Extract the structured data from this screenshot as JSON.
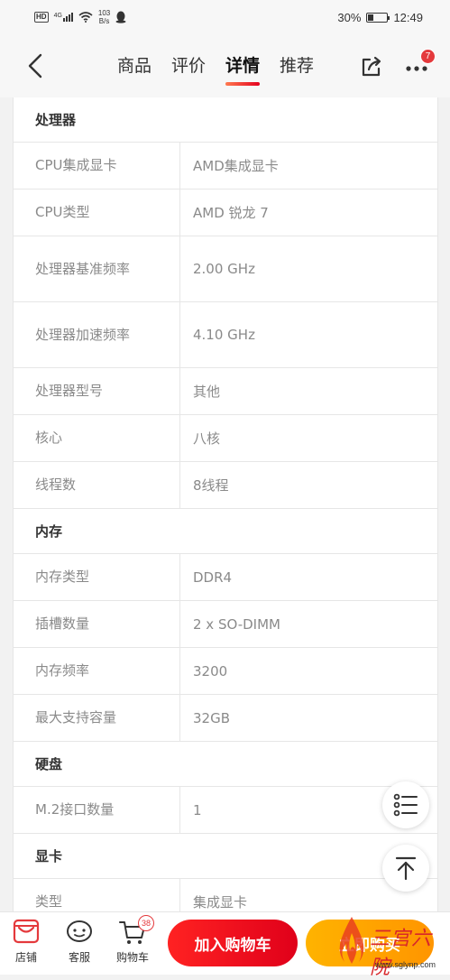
{
  "status_bar": {
    "network_tag": "HD",
    "signal": "4G",
    "speed_value": "103",
    "speed_unit": "B/s",
    "battery_percent": "30%",
    "battery_level": 0.3,
    "time": "12:49"
  },
  "nav": {
    "tabs": [
      {
        "label": "商品",
        "active": false
      },
      {
        "label": "评价",
        "active": false
      },
      {
        "label": "详情",
        "active": true
      },
      {
        "label": "推荐",
        "active": false
      }
    ],
    "more_badge": "7"
  },
  "specs": {
    "processor": {
      "title": "处理器",
      "rows": [
        {
          "label": "CPU集成显卡",
          "value": "AMD集成显卡"
        },
        {
          "label": "CPU类型",
          "value": "AMD 锐龙 7"
        },
        {
          "label": "处理器基准频率",
          "value": "2.00 GHz"
        },
        {
          "label": "处理器加速频率",
          "value": "4.10 GHz"
        },
        {
          "label": "处理器型号",
          "value": "其他"
        },
        {
          "label": "核心",
          "value": "八核"
        },
        {
          "label": "线程数",
          "value": "8线程"
        }
      ]
    },
    "memory": {
      "title": "内存",
      "rows": [
        {
          "label": "内存类型",
          "value": "DDR4"
        },
        {
          "label": "插槽数量",
          "value": "2 x SO-DIMM"
        },
        {
          "label": "内存频率",
          "value": "3200"
        },
        {
          "label": "最大支持容量",
          "value": "32GB"
        }
      ]
    },
    "disk": {
      "title": "硬盘",
      "rows": [
        {
          "label": "M.2接口数量",
          "value": "1"
        }
      ]
    },
    "gpu": {
      "title": "显卡",
      "rows": [
        {
          "label": "类型",
          "value": "集成显卡"
        }
      ]
    }
  },
  "bottom_bar": {
    "shop": "店铺",
    "service": "客服",
    "cart": "购物车",
    "cart_count": "38",
    "add_to_cart": "加入购物车",
    "buy_now": "立即购买"
  },
  "watermark": {
    "text": "三宫六院",
    "url": "www.sglynp.com"
  },
  "colors": {
    "accent_red": "#e4001e",
    "accent_orange": "#ff9500"
  }
}
